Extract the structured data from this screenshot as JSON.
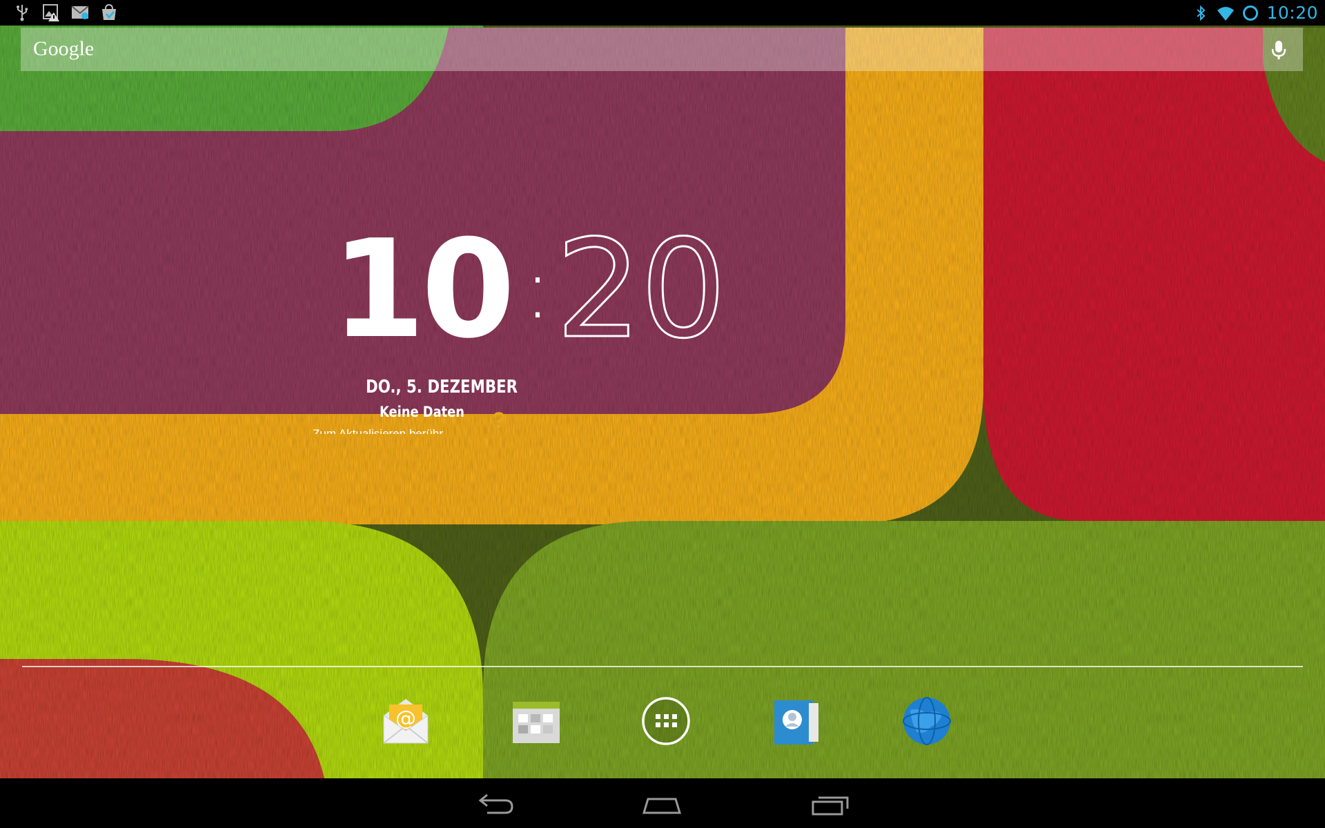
{
  "status_bar": {
    "time": "10:20",
    "accent_color": "#33b5e5",
    "left_icons": [
      "usb-icon",
      "image-warning-icon",
      "gmail-icon",
      "play-store-update-icon"
    ],
    "right_icons": [
      "bluetooth-icon",
      "wifi-icon",
      "sync-icon"
    ]
  },
  "search": {
    "logo": "Google",
    "voice_icon": "mic-icon"
  },
  "clock": {
    "hours": "10",
    "separator": ":",
    "minutes": "20",
    "date": "DO., 5. DEZEMBER"
  },
  "weather": {
    "title": "Keine Daten",
    "subtitle": "Zum Aktualisieren berühr",
    "icon": "question-mark-icon"
  },
  "dock": {
    "apps": [
      {
        "icon": "email-icon"
      },
      {
        "icon": "gallery-icon"
      },
      {
        "icon": "app-drawer-icon"
      },
      {
        "icon": "contacts-icon"
      },
      {
        "icon": "browser-globe-icon"
      }
    ]
  },
  "nav_bar": {
    "buttons": [
      "back-icon",
      "home-icon",
      "recent-apps-icon"
    ]
  }
}
